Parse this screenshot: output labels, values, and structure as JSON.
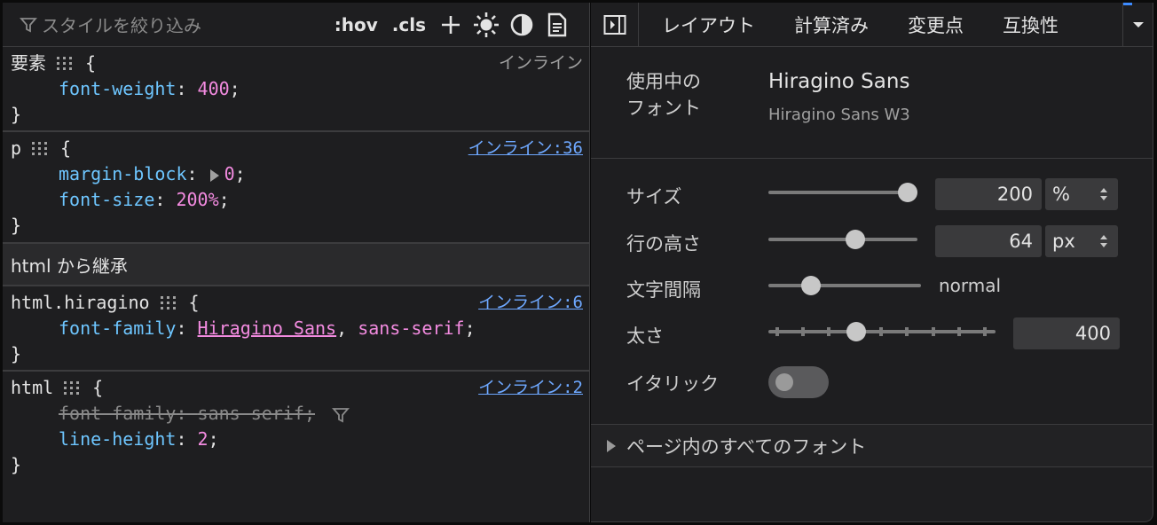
{
  "left": {
    "filter_placeholder": "スタイルを絞り込み",
    "toolbar": {
      "hov": ":hov",
      "cls": ".cls"
    },
    "icons": [
      "filter-icon",
      "add-icon",
      "sun-icon",
      "contrast-icon",
      "document-icon"
    ],
    "rules": [
      {
        "selector": "要素",
        "source": "インライン",
        "declarations": [
          {
            "prop": "font-weight",
            "value": "400"
          }
        ]
      },
      {
        "selector": "p",
        "source": "インライン:36",
        "declarations": [
          {
            "prop": "margin-block",
            "value": "0"
          },
          {
            "prop": "font-size",
            "value": "200%"
          }
        ]
      }
    ],
    "inherited_header": "html から継承",
    "inherited_rules": [
      {
        "selector": "html.hiragino",
        "source": "インライン:6",
        "declarations": [
          {
            "prop": "font-family",
            "value_link": "Hiragino Sans",
            "value_rest": "sans-serif"
          }
        ]
      },
      {
        "selector": "html",
        "source": "インライン:2",
        "declarations": [
          {
            "prop": "font-family",
            "value": "sans-serif",
            "overridden": true
          },
          {
            "prop": "line-height",
            "value": "2"
          }
        ]
      }
    ],
    "brace_open": "{",
    "brace_close": "}"
  },
  "right": {
    "tabs": [
      "レイアウト",
      "計算済み",
      "変更点",
      "互換性"
    ],
    "font_used": {
      "label": "使用中のフォント",
      "label_line1": "使用中の",
      "label_line2": "フォント",
      "name": "Hiragino Sans",
      "sub": "Hiragino Sans W3"
    },
    "properties": {
      "size": {
        "label": "サイズ",
        "value": "200",
        "unit": "%",
        "slider_fraction": 0.98
      },
      "line_height": {
        "label": "行の高さ",
        "value": "64",
        "unit": "px",
        "slider_fraction": 0.58
      },
      "letter_spacing": {
        "label": "文字間隔",
        "value": "normal",
        "slider_fraction": 0.28
      },
      "weight": {
        "label": "太さ",
        "value": "400",
        "slider_fraction": 0.375
      },
      "italic": {
        "label": "イタリック",
        "on": false
      }
    },
    "all_fonts": "ページ内のすべてのフォント"
  },
  "colors": {
    "background": "#1e1e20",
    "property": "#6ec6ff",
    "value": "#f38be0",
    "link": "#6ea8ff"
  }
}
